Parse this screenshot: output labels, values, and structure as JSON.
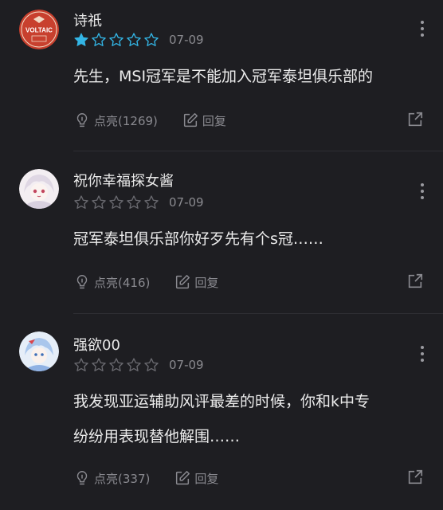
{
  "colors": {
    "background": "#1e1e22",
    "star_filled": "#33b5e5",
    "star_empty": "#6a6a70",
    "muted": "#8a8a90"
  },
  "comments": [
    {
      "username": "诗祇",
      "rating": 1,
      "date": "07-09",
      "text": "先生，MSI冠军是不能加入冠军泰坦俱乐部的",
      "like_label": "点亮(1269)",
      "reply_label": "回复",
      "avatar_text": "VOLTAIC"
    },
    {
      "username": "祝你幸福探女酱",
      "rating": 0,
      "date": "07-09",
      "text": "冠军泰坦俱乐部你好歹先有个s冠……",
      "like_label": "点亮(416)",
      "reply_label": "回复"
    },
    {
      "username": "强欲00",
      "rating": 0,
      "date": "07-09",
      "text_line1": "我发现亚运辅助风评最差的时候，你和k中专",
      "text_line2": "纷纷用表现替他解围……",
      "like_label": "点亮(337)",
      "reply_label": "回复"
    }
  ]
}
